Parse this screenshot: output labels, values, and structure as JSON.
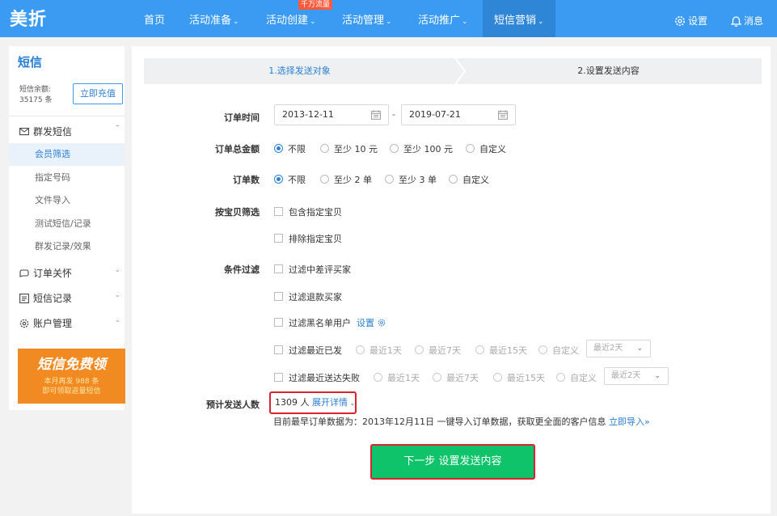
{
  "app": {
    "logo": "美折"
  },
  "nav": {
    "items": [
      {
        "label": "首页",
        "has_dropdown": false
      },
      {
        "label": "活动准备",
        "has_dropdown": true
      },
      {
        "label": "活动创建",
        "has_dropdown": true,
        "badge": "千万流量"
      },
      {
        "label": "活动管理",
        "has_dropdown": true
      },
      {
        "label": "活动推广",
        "has_dropdown": true
      },
      {
        "label": "短信营销",
        "has_dropdown": true,
        "active": true
      }
    ],
    "settings_label": "设置",
    "messages_label": "消息"
  },
  "sidebar": {
    "title": "短信",
    "balance_label": "短信余额:",
    "balance_value": "35175 条",
    "recharge_button": "立即充值",
    "groups": [
      {
        "label": "群发短信",
        "icon": "sms-icon",
        "expanded": true,
        "items": [
          {
            "label": "会员筛选",
            "active": true
          },
          {
            "label": "指定号码"
          },
          {
            "label": "文件导入"
          },
          {
            "label": "测试短信/记录"
          },
          {
            "label": "群发记录/效果"
          }
        ]
      },
      {
        "label": "订单关怀",
        "icon": "care-icon",
        "expanded": false
      },
      {
        "label": "短信记录",
        "icon": "record-icon",
        "expanded": false
      },
      {
        "label": "账户管理",
        "icon": "gear-icon",
        "expanded": false
      }
    ],
    "promo": {
      "title": "短信免费领",
      "line1": "本月再发 988 条",
      "line2": "即可领取返量短信"
    }
  },
  "steps": [
    {
      "label": "1.选择发送对象",
      "active": true
    },
    {
      "label": "2.设置发送内容",
      "active": false
    }
  ],
  "form": {
    "order_time": {
      "label": "订单时间",
      "start_date": "2013-12-11",
      "separator": "-",
      "end_date": "2019-07-21"
    },
    "order_amount": {
      "label": "订单总金额",
      "options": [
        "不限",
        "至少 10 元",
        "至少 100 元",
        "自定义"
      ],
      "selected": "不限"
    },
    "order_count": {
      "label": "订单数",
      "options": [
        "不限",
        "至少 2 单",
        "至少 3 单",
        "自定义"
      ],
      "selected": "不限"
    },
    "product_filter": {
      "label": "按宝贝筛选",
      "include_label": "包含指定宝贝",
      "exclude_label": "排除指定宝贝"
    },
    "condition_filter": {
      "label": "条件过滤",
      "bad_review": "过滤中差评买家",
      "refund": "过滤退款买家",
      "blacklist": "过滤黑名单用户",
      "blacklist_setting": "设置",
      "recent_sent": {
        "label": "过滤最近已发",
        "options": [
          "最近1天",
          "最近7天",
          "最近15天",
          "自定义"
        ],
        "select_value": "最近2天"
      },
      "recent_failed": {
        "label": "过滤最近送达失败",
        "options": [
          "最近1天",
          "最近7天",
          "最近15天",
          "自定义"
        ],
        "select_value": "最近2天"
      }
    },
    "estimate": {
      "label": "预计发送人数",
      "count": "1309 人",
      "expand_link": "展开详情",
      "note_prefix": "目前最早订单数据为：2013年12月11日  一键导入订单数据，获取更全面的客户信息",
      "import_link": "立即导入»"
    },
    "next_button": "下一步 设置发送内容"
  },
  "colors": {
    "primary": "#3b9bf3",
    "nav_active": "#2f86d6",
    "link": "#2a7fd4",
    "success": "#0fc36a",
    "highlight_border": "#d9232f",
    "promo": "#f28a22"
  }
}
